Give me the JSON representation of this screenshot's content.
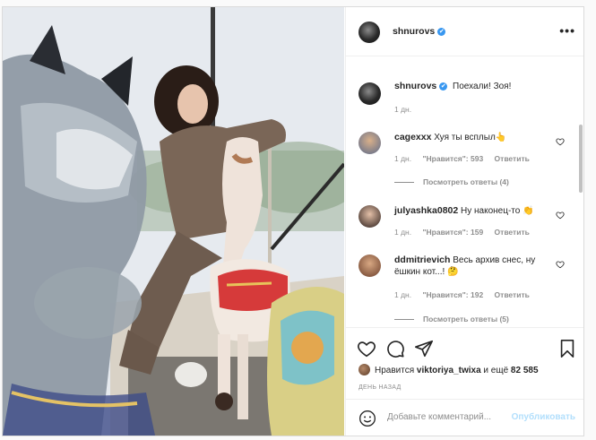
{
  "post": {
    "author": "shnurovs",
    "verified_glyph": "✔",
    "more_glyph": "•••"
  },
  "caption": {
    "author": "shnurovs",
    "text": "Поехали! Зоя!",
    "age": "1 дн."
  },
  "comments": [
    {
      "user": "cagexxx",
      "text": "Хуя ты всплыл👆",
      "age": "1 дн.",
      "likes": "\"Нравится\": 593",
      "reply": "Ответить",
      "replies": "Посмотреть ответы (4)"
    },
    {
      "user": "julyashka0802",
      "text": "Ну наконец-то 👏",
      "age": "1 дн.",
      "likes": "\"Нравится\": 159",
      "reply": "Ответить"
    },
    {
      "user": "ddmitrievich",
      "text": "Весь архив снес, ну ёшкин кот...! 🤔",
      "age": "1 дн.",
      "likes": "\"Нравится\": 192",
      "reply": "Ответить",
      "replies": "Посмотреть ответы (5)"
    }
  ],
  "likes": {
    "prefix": "Нравится",
    "user": "viktoriya_twixa",
    "middle": "и ещё",
    "count": "82 585"
  },
  "date_label": "ДЕНЬ НАЗАД",
  "composer": {
    "placeholder": "Добавьте комментарий...",
    "publish": "Опубликовать",
    "emoji_icon": "smiley-icon"
  },
  "colors": {
    "verified": "#3897f0",
    "publish_disabled": "#b2dffc",
    "muted": "#8e8e8e"
  }
}
